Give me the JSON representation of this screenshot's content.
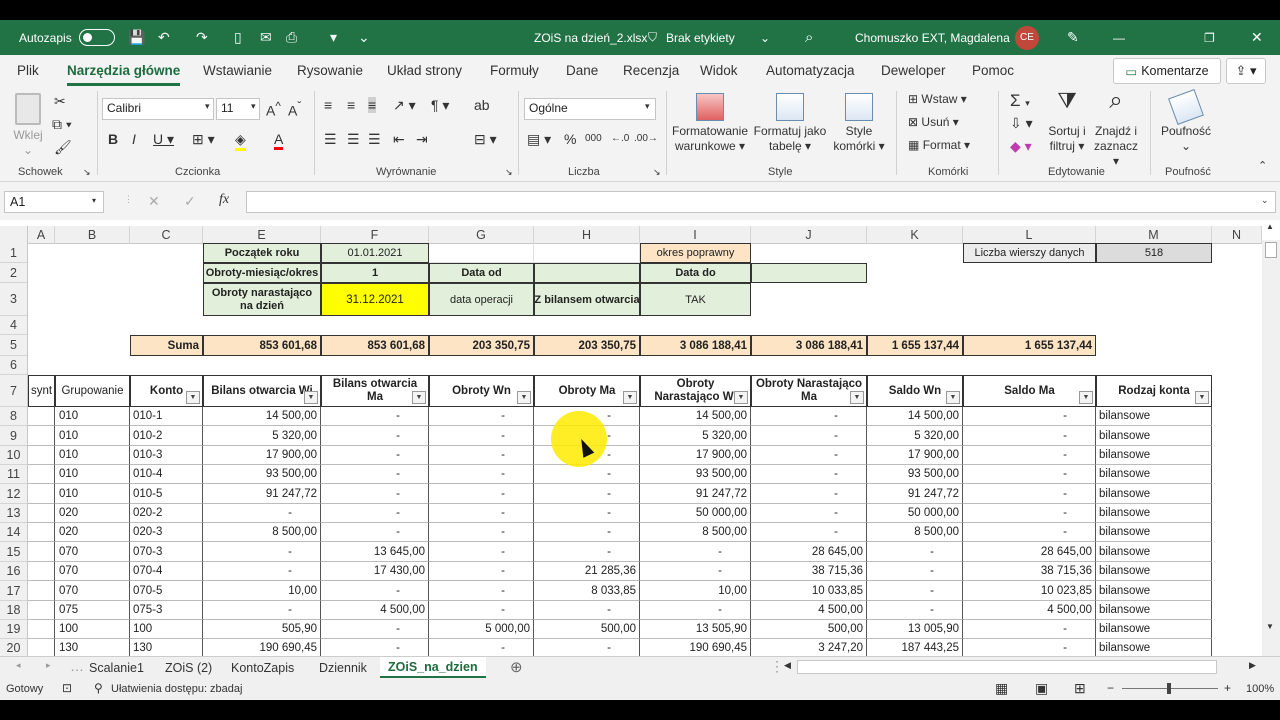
{
  "titlebar": {
    "autosave_label": "Autozapis",
    "file_title": "ZOiS na dzień_2.xlsx",
    "label_tag": "Brak etykiety",
    "user_name": "Chomuszko EXT, Magdalena",
    "user_initials": "CE"
  },
  "menu": {
    "tabs": [
      "Plik",
      "Narzędzia główne",
      "Wstawianie",
      "Rysowanie",
      "Układ strony",
      "Formuły",
      "Dane",
      "Recenzja",
      "Widok",
      "Automatyzacja",
      "Deweloper",
      "Pomoc"
    ],
    "active_tab": "Narzędzia główne",
    "comments_label": "Komentarze"
  },
  "ribbon": {
    "paste_label": "Wklej",
    "groups": [
      "Schowek",
      "Czcionka",
      "Wyrównanie",
      "Liczba",
      "Style",
      "Komórki",
      "Edytowanie",
      "Poufność"
    ],
    "font_name": "Calibri",
    "font_size": "11",
    "number_format": "Ogólne",
    "cond_format": "Formatowanie warunkowe",
    "format_table": "Formatuj jako tabelę",
    "cell_styles": "Style komórki",
    "insert": "Wstaw",
    "delete": "Usuń",
    "format": "Format",
    "sort_filter": "Sortuj i filtruj",
    "find_select": "Znajdź i zaznacz",
    "sensitivity": "Poufność"
  },
  "formula_bar": {
    "name_box": "A1",
    "fx": "fx",
    "formula": ""
  },
  "columns": [
    "A",
    "B",
    "C",
    "E",
    "F",
    "G",
    "H",
    "I",
    "J",
    "K",
    "L",
    "M",
    "N"
  ],
  "rows": [
    "1",
    "2",
    "3",
    "4",
    "5",
    "6",
    "7",
    "8",
    "9",
    "10",
    "11",
    "12",
    "13",
    "14",
    "15",
    "16",
    "17",
    "18",
    "19",
    "20"
  ],
  "params": {
    "start_label": "Początek roku",
    "start_value": "01.01.2021",
    "turnover_label": "Obroty-miesiąc/okres",
    "turnover_value": "1",
    "date_from_label": "Data od",
    "period_ok": "okres poprawny",
    "date_to_label": "Data do",
    "cumulative_label": "Obroty narastająco na dzień",
    "cumulative_value": "31.12.2021",
    "op_date": "data operacji",
    "opening_label": "Z bilansem otwarcia",
    "opening_value": "TAK",
    "rows_count_label": "Liczba wierszy danych",
    "rows_count_value": "518"
  },
  "sum_row": {
    "label": "Suma",
    "values": [
      "853 601,68",
      "853 601,68",
      "203 350,75",
      "203 350,75",
      "3 086 188,41",
      "3 086 188,41",
      "1 655 137,44",
      "1 655 137,44"
    ]
  },
  "table_headers": [
    "synt",
    "Grupowanie",
    "Konto",
    "Bilans otwarcia Wi",
    "Bilans otwarcia Ma",
    "Obroty Wn",
    "Obroty Ma",
    "Obroty Narastająco Wi",
    "Obroty Narastająco Ma",
    "Saldo Wn",
    "Saldo Ma",
    "Rodzaj konta"
  ],
  "table_rows": [
    [
      "010",
      "010-1",
      "14 500,00",
      "-",
      "-",
      "-",
      "14 500,00",
      "-",
      "14 500,00",
      "-",
      "bilansowe"
    ],
    [
      "010",
      "010-2",
      "5 320,00",
      "-",
      "-",
      "-",
      "5 320,00",
      "-",
      "5 320,00",
      "-",
      "bilansowe"
    ],
    [
      "010",
      "010-3",
      "17 900,00",
      "-",
      "-",
      "-",
      "17 900,00",
      "-",
      "17 900,00",
      "-",
      "bilansowe"
    ],
    [
      "010",
      "010-4",
      "93 500,00",
      "-",
      "-",
      "-",
      "93 500,00",
      "-",
      "93 500,00",
      "-",
      "bilansowe"
    ],
    [
      "010",
      "010-5",
      "91 247,72",
      "-",
      "-",
      "-",
      "91 247,72",
      "-",
      "91 247,72",
      "-",
      "bilansowe"
    ],
    [
      "020",
      "020-2",
      "-",
      "-",
      "-",
      "-",
      "50 000,00",
      "-",
      "50 000,00",
      "-",
      "bilansowe"
    ],
    [
      "020",
      "020-3",
      "8 500,00",
      "-",
      "-",
      "-",
      "8 500,00",
      "-",
      "8 500,00",
      "-",
      "bilansowe"
    ],
    [
      "070",
      "070-3",
      "-",
      "13 645,00",
      "-",
      "-",
      "-",
      "28 645,00",
      "-",
      "28 645,00",
      "bilansowe"
    ],
    [
      "070",
      "070-4",
      "-",
      "17 430,00",
      "-",
      "21 285,36",
      "-",
      "38 715,36",
      "-",
      "38 715,36",
      "bilansowe"
    ],
    [
      "070",
      "070-5",
      "10,00",
      "-",
      "-",
      "8 033,85",
      "10,00",
      "10 033,85",
      "-",
      "10 023,85",
      "bilansowe"
    ],
    [
      "075",
      "075-3",
      "-",
      "4 500,00",
      "-",
      "-",
      "-",
      "4 500,00",
      "-",
      "4 500,00",
      "bilansowe"
    ],
    [
      "100",
      "100",
      "505,90",
      "-",
      "5 000,00",
      "500,00",
      "13 505,90",
      "500,00",
      "13 005,90",
      "-",
      "bilansowe"
    ],
    [
      "130",
      "130",
      "190 690,45",
      "-",
      "-",
      "-",
      "190 690,45",
      "3 247,20",
      "187 443,25",
      "-",
      "bilansowe"
    ]
  ],
  "sheets": [
    "Scalanie1",
    "ZOiS (2)",
    "KontoZapis",
    "Dziennik",
    "ZOiS_na_dzien"
  ],
  "active_sheet": "ZOiS_na_dzien",
  "status": {
    "ready": "Gotowy",
    "accessibility": "Ułatwienia dostępu: zbadaj",
    "zoom": "100%"
  }
}
